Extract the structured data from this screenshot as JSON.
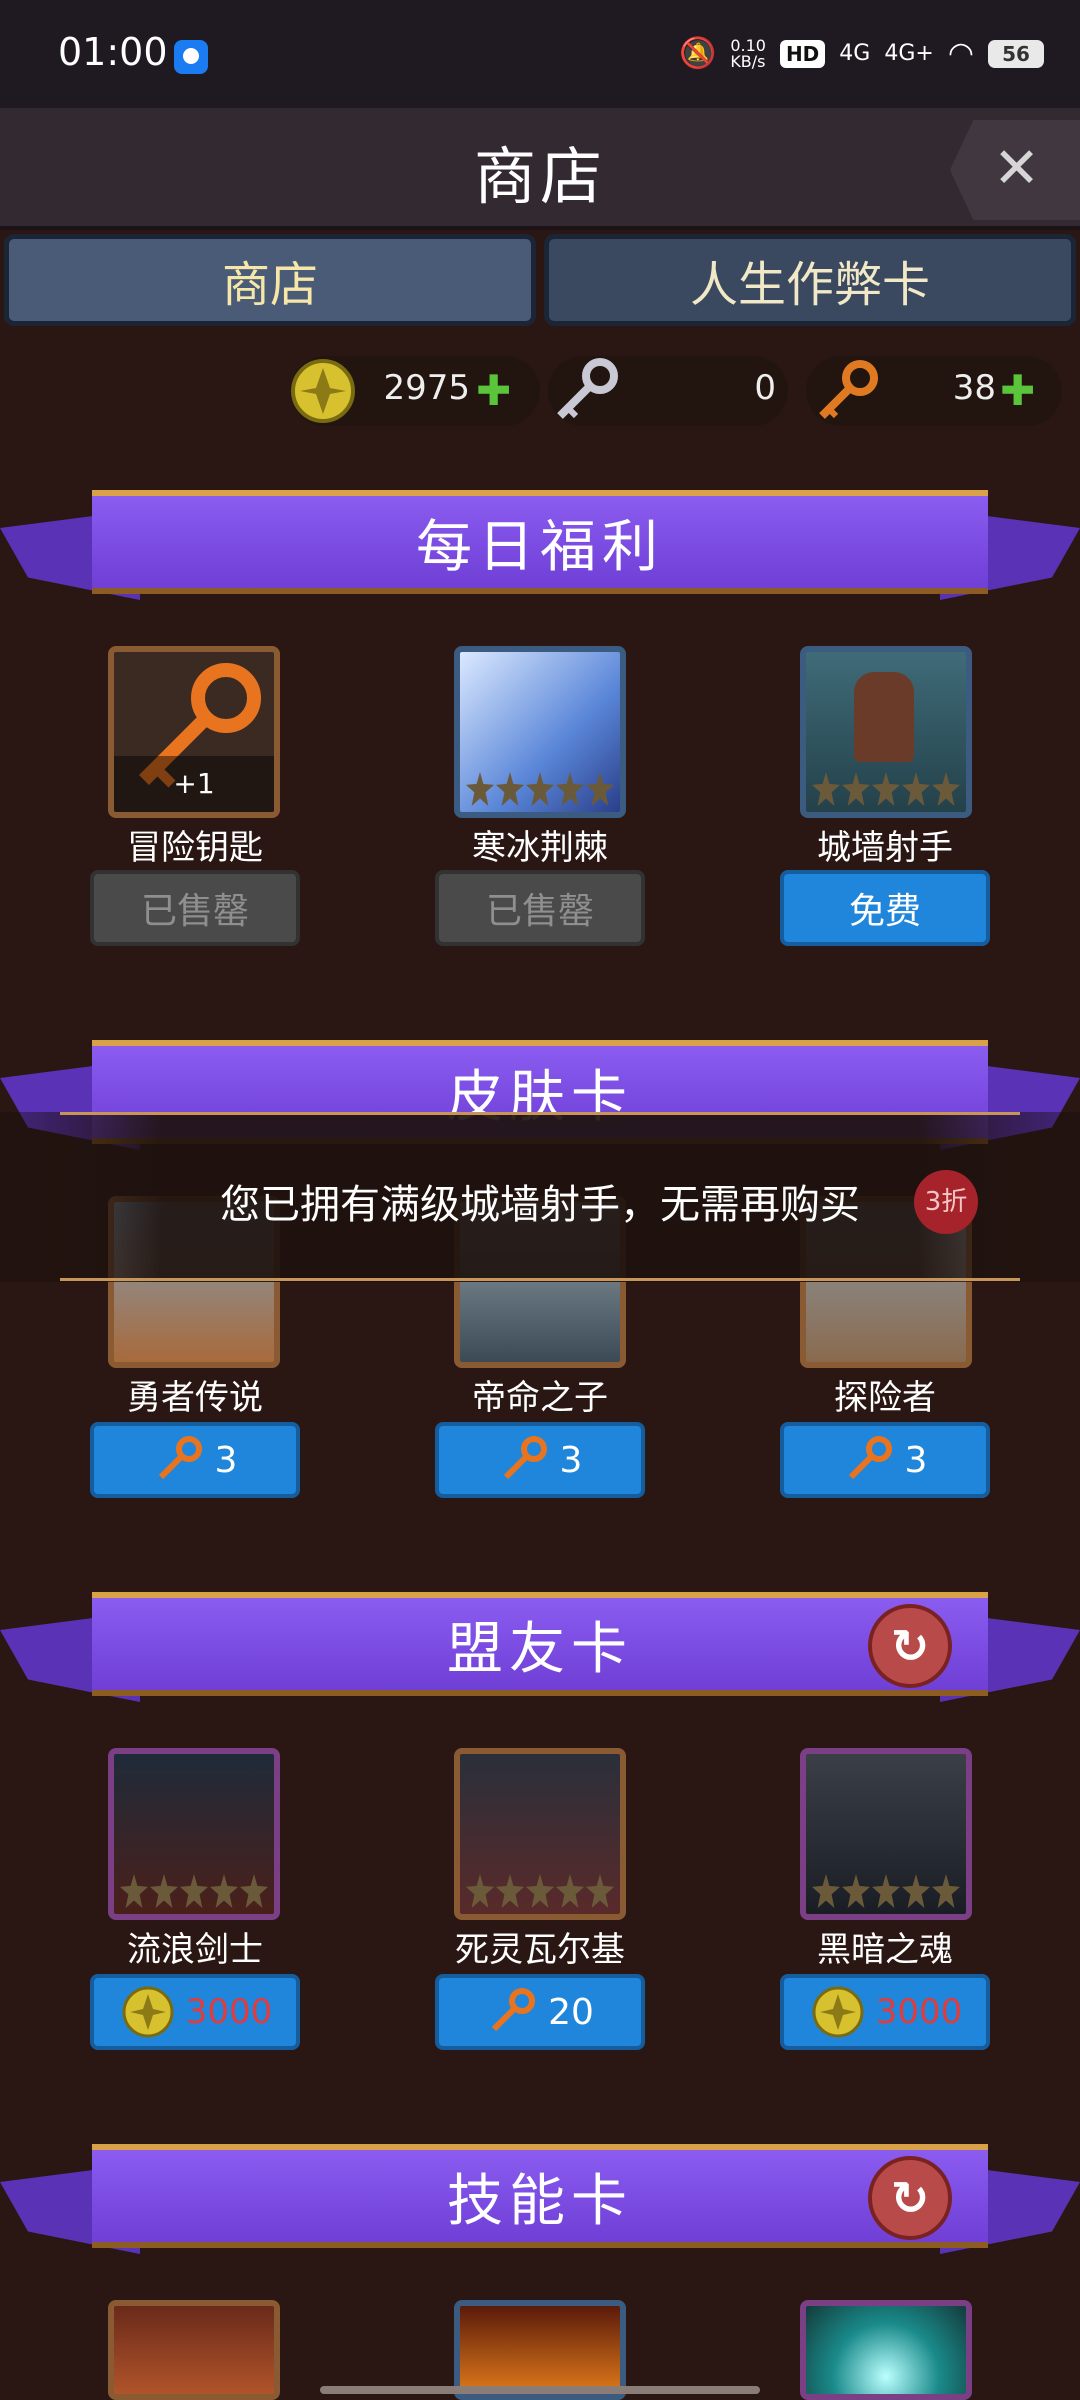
{
  "status": {
    "time": "01:00",
    "net": "0.10\nKB/s",
    "sig1": "4G",
    "sig2": "4G+",
    "hd": "HD",
    "battery": "56"
  },
  "header": {
    "title": "商店"
  },
  "tabs": [
    {
      "label": "商店"
    },
    {
      "label": "人生作弊卡"
    }
  ],
  "currency": {
    "gold": "2975",
    "silver_key": "0",
    "bronze_key": "38"
  },
  "sections": {
    "daily": {
      "title": "每日福利",
      "items": [
        {
          "label": "冒险钥匙",
          "badge": "+1",
          "button": "已售罄"
        },
        {
          "label": "寒冰荆棘",
          "button": "已售罄"
        },
        {
          "label": "城墙射手",
          "button": "免费"
        }
      ]
    },
    "skin": {
      "title": "皮肤卡",
      "discount": "3折",
      "items": [
        {
          "label": "勇者传说",
          "price": "3"
        },
        {
          "label": "帝命之子",
          "price": "3"
        },
        {
          "label": "探险者",
          "price": "3"
        }
      ]
    },
    "ally": {
      "title": "盟友卡",
      "items": [
        {
          "label": "流浪剑士",
          "price": "3000"
        },
        {
          "label": "死灵瓦尔基",
          "price": "20"
        },
        {
          "label": "黑暗之魂",
          "price": "3000"
        }
      ]
    },
    "skill": {
      "title": "技能卡"
    }
  },
  "toast": {
    "message": "您已拥有满级城墙射手，无需再购买"
  },
  "colors": {
    "banner": "#7a48e0",
    "button_blue": "#1f86db",
    "price_red": "#e23b3b"
  }
}
